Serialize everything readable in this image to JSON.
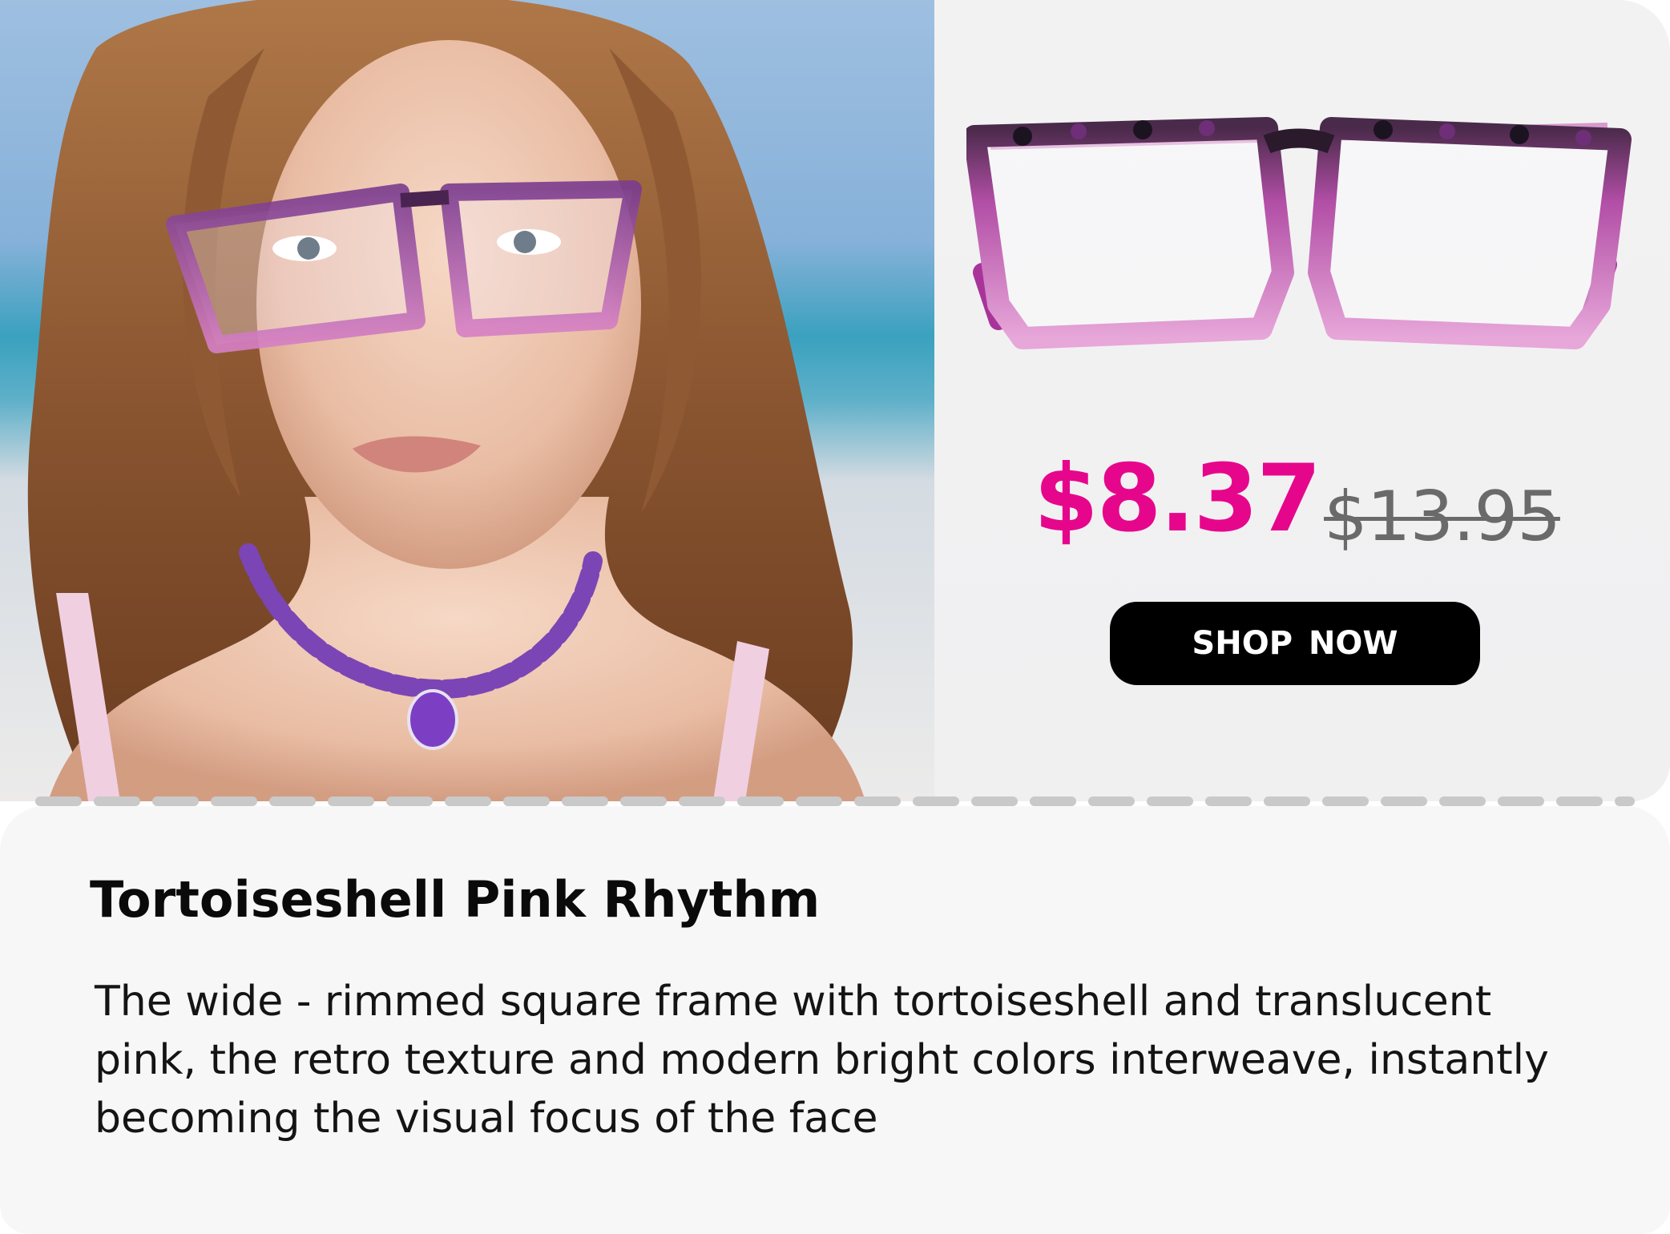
{
  "product": {
    "name": "Tortoiseshell Pink Rhythm",
    "description": "The wide - rimmed square frame with tortoiseshell and translucent pink, the retro texture and modern bright colors interweave, instantly becoming the visual focus of the face",
    "price_current": "$8.37",
    "price_original": "$13.95",
    "cta_label": "SHOP NOW"
  },
  "colors": {
    "accent_price": "#e6068c",
    "button_bg": "#000000",
    "button_text": "#ffffff",
    "panel_bg": "#f2f2f3",
    "info_bg": "#f7f7f7"
  },
  "images": {
    "model_photo": "model-wearing-glasses-photo",
    "product_photo": "glasses-product-photo"
  }
}
